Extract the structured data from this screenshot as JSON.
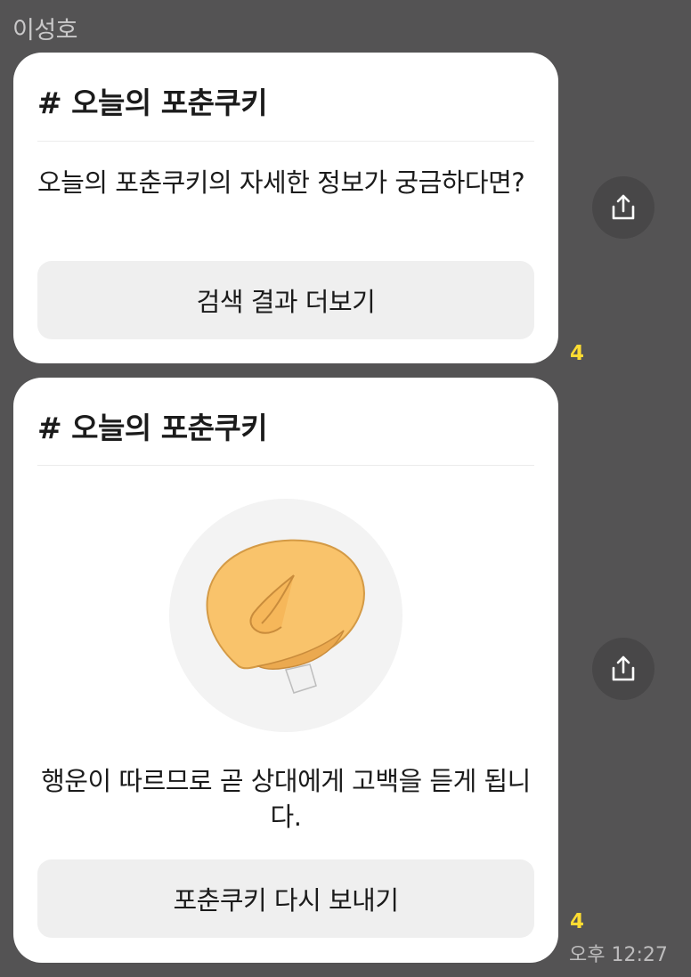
{
  "chat": {
    "sender_name": "이성호",
    "time": "오후 12:27"
  },
  "messages": [
    {
      "title": "# 오늘의 포춘쿠키",
      "body": "오늘의 포춘쿠키의 자세한 정보가 궁금하다면?",
      "button_label": "검색 결과 더보기",
      "unread_count": "4",
      "share_icon": "share-icon"
    },
    {
      "title": "# 오늘의 포춘쿠키",
      "image": "fortune-cookie-icon",
      "body": "행운이 따르므로 곧 상대에게 고백을 듣게 됩니다.",
      "button_label": "포춘쿠키 다시 보내기",
      "unread_count": "4",
      "share_icon": "share-icon"
    }
  ],
  "colors": {
    "background": "#545354",
    "card": "#ffffff",
    "button": "#efefef",
    "unread": "#fedc32",
    "cookie": "#f9c36b"
  }
}
